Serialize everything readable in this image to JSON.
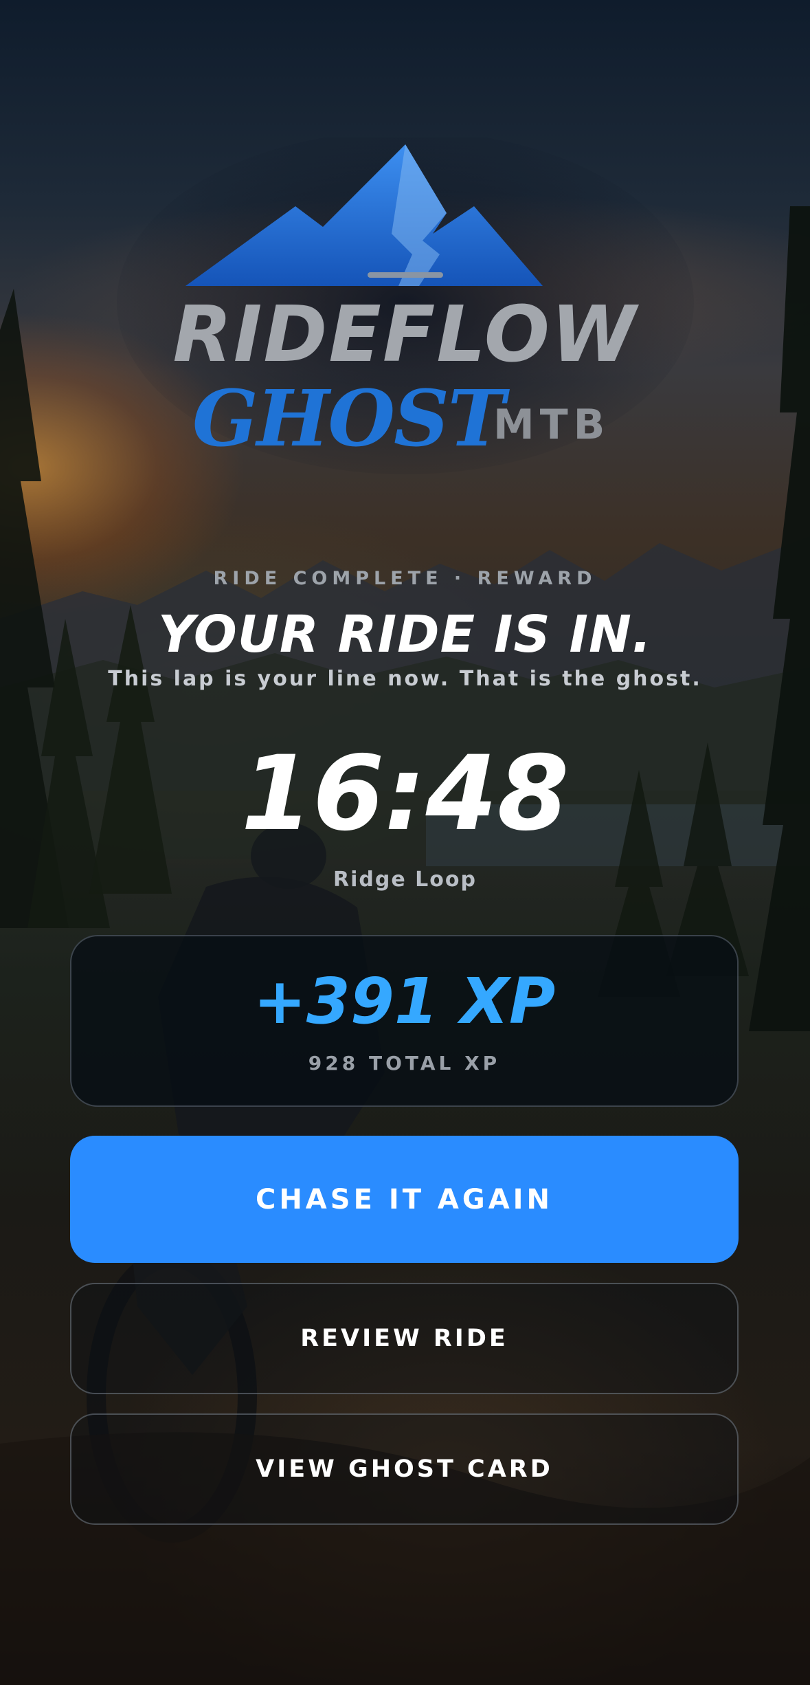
{
  "brand": {
    "name_primary": "RIDEFLOW",
    "name_secondary": "GHOST",
    "name_suffix": "MTB",
    "logo_icon": "mountain-icon"
  },
  "result": {
    "eyebrow": "RIDE COMPLETE · REWARD",
    "headline": "YOUR RIDE IS IN.",
    "subline": "This lap is your line now. That is the ghost.",
    "time": "16:48",
    "route_name": "Ridge Loop"
  },
  "xp": {
    "gained": "+391 XP",
    "total": "928 TOTAL XP"
  },
  "actions": {
    "chase_again": "CHASE IT AGAIN",
    "review_ride": "REVIEW RIDE",
    "view_ghost_card": "VIEW GHOST CARD"
  },
  "colors": {
    "accent": "#2a8cff",
    "xp_text": "#35a8ff",
    "logo_blue": "#1f73d6",
    "logo_grey": "#9a9ea4"
  }
}
